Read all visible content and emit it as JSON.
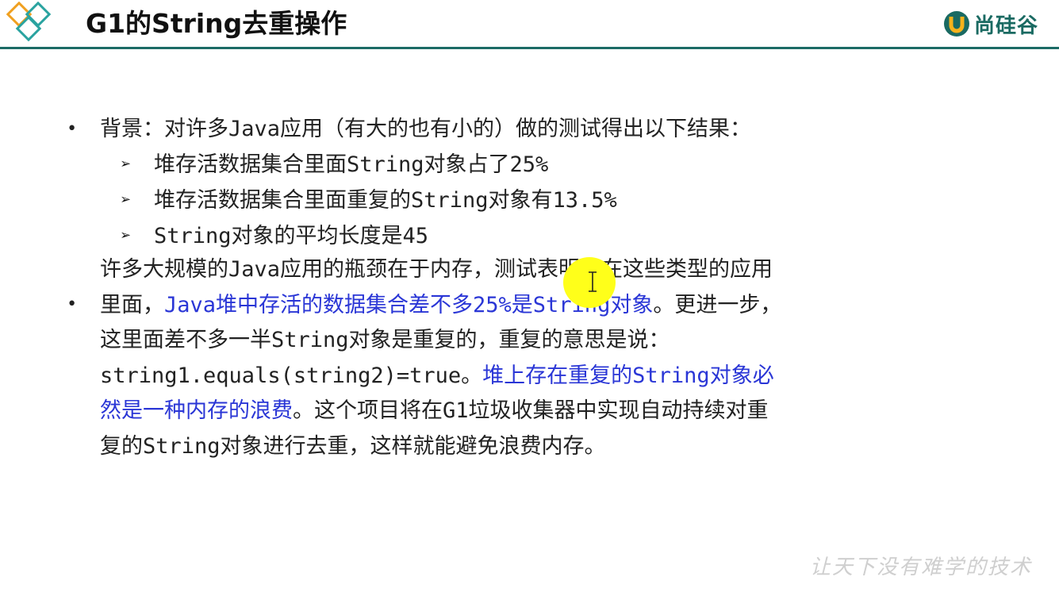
{
  "header": {
    "title": "G1的String去重操作",
    "brand": "尚硅谷",
    "accent_color": "#1c6b66",
    "logo_icon": "diamond-logo-icon"
  },
  "bullet1": {
    "text": "背景：对许多Java应用（有大的也有小的）做的测试得出以下结果：",
    "sub_items": [
      "堆存活数据集合里面String对象占了25%",
      "堆存活数据集合里面重复的String对象有13.5%",
      "String对象的平均长度是45"
    ]
  },
  "bullet2": {
    "line1": "许多大规模的Java应用的瓶颈在于内存，测试表明，在这些类型的应用",
    "line2_a": "里面，",
    "line2_hl": "Java堆中存活的数据集合差不多25%是String对象",
    "line2_b": "。更进一步，",
    "line3": "这里面差不多一半String对象是重复的，重复的意思是说：",
    "line4_a": "string1.equals(string2)=true。",
    "line4_hl": "堆上存在重复的String对象必",
    "line5_hl": "然是一种内存的浪费",
    "line5_b": "。这个项目将在G1垃圾收集器中实现自动持续对重",
    "line6": "复的String对象进行去重，这样就能避免浪费内存。",
    "highlight_color": "#2a36d6"
  },
  "watermark": "让天下没有难学的技术"
}
